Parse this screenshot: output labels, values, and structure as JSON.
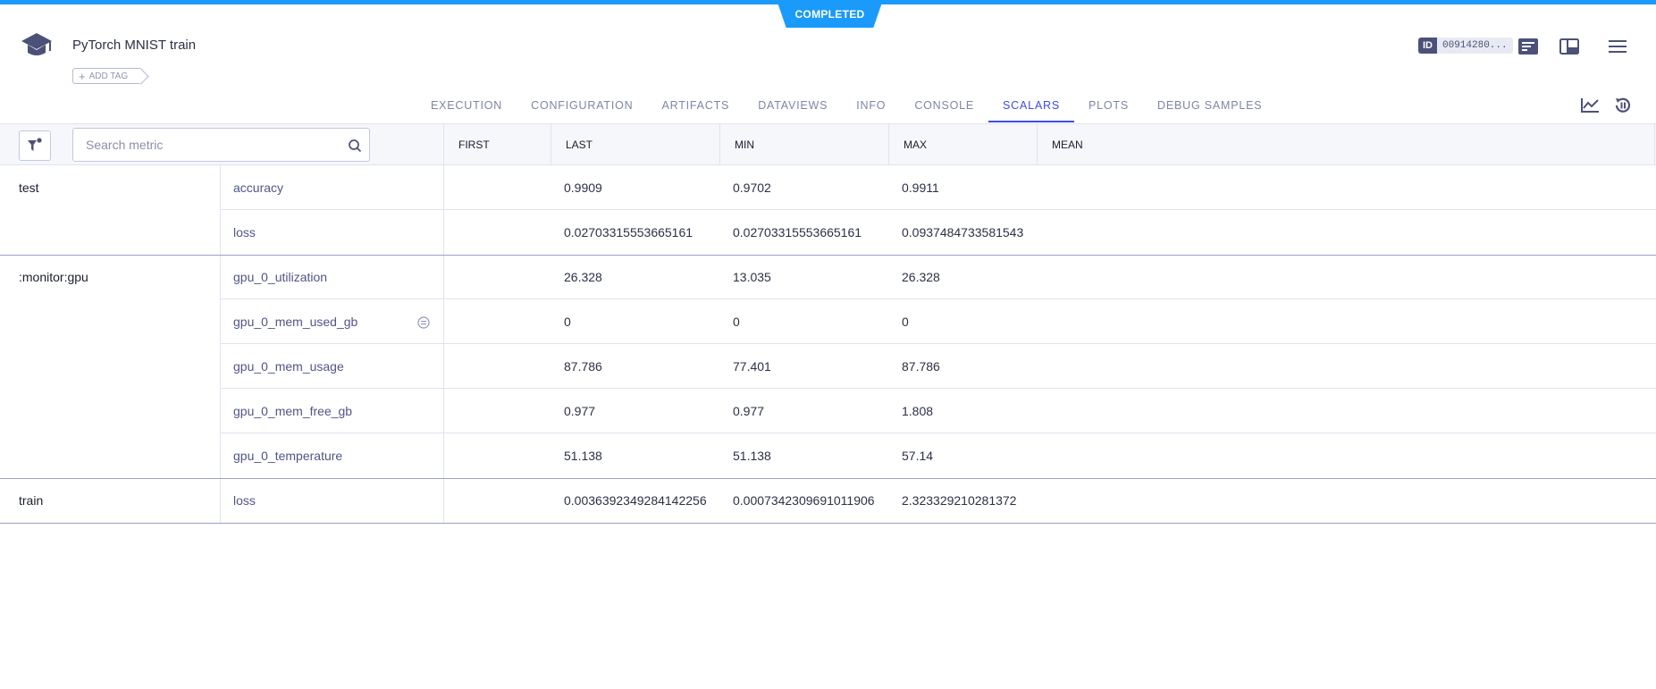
{
  "status": {
    "label": "COMPLETED",
    "color": "#1a9bfc"
  },
  "task": {
    "title": "PyTorch MNIST train",
    "add_tag": "ADD TAG",
    "id_label": "ID",
    "id_value": "00914280..."
  },
  "header_icons": [
    "graduation-cap-icon",
    "info-panel-icon",
    "layout-icon",
    "menu-icon"
  ],
  "tabs": [
    {
      "label": "EXECUTION",
      "active": false
    },
    {
      "label": "CONFIGURATION",
      "active": false
    },
    {
      "label": "ARTIFACTS",
      "active": false
    },
    {
      "label": "DATAVIEWS",
      "active": false
    },
    {
      "label": "INFO",
      "active": false
    },
    {
      "label": "CONSOLE",
      "active": false
    },
    {
      "label": "SCALARS",
      "active": true
    },
    {
      "label": "PLOTS",
      "active": false
    },
    {
      "label": "DEBUG SAMPLES",
      "active": false
    }
  ],
  "tab_accent": "#3f4ce0",
  "search": {
    "placeholder": "Search metric"
  },
  "columns": [
    "FIRST",
    "LAST",
    "MIN",
    "MAX",
    "MEAN"
  ],
  "rows": [
    {
      "group": "test",
      "metric": "accuracy",
      "first": "",
      "last": "0.9909",
      "min": "0.9702",
      "max": "0.9911",
      "mean": ""
    },
    {
      "group": "",
      "metric": "loss",
      "first": "",
      "last": "0.02703315553665161",
      "min": "0.02703315553665161",
      "max": "0.0937484733581543",
      "mean": ""
    },
    {
      "group": ":monitor:gpu",
      "metric": "gpu_0_utilization",
      "first": "",
      "last": "26.328",
      "min": "13.035",
      "max": "26.328",
      "mean": ""
    },
    {
      "group": "",
      "metric": "gpu_0_mem_used_gb",
      "first": "",
      "last": "0",
      "min": "0",
      "max": "0",
      "mean": ""
    },
    {
      "group": "",
      "metric": "gpu_0_mem_usage",
      "first": "",
      "last": "87.786",
      "min": "77.401",
      "max": "87.786",
      "mean": ""
    },
    {
      "group": "",
      "metric": "gpu_0_mem_free_gb",
      "first": "",
      "last": "0.977",
      "min": "0.977",
      "max": "1.808",
      "mean": ""
    },
    {
      "group": "",
      "metric": "gpu_0_temperature",
      "first": "",
      "last": "51.138",
      "min": "51.138",
      "max": "57.14",
      "mean": ""
    },
    {
      "group": "train",
      "metric": "loss",
      "first": "",
      "last": "0.0036392349284142256",
      "min": "0.0007342309691011906",
      "max": "2.323329210281372",
      "mean": ""
    }
  ]
}
